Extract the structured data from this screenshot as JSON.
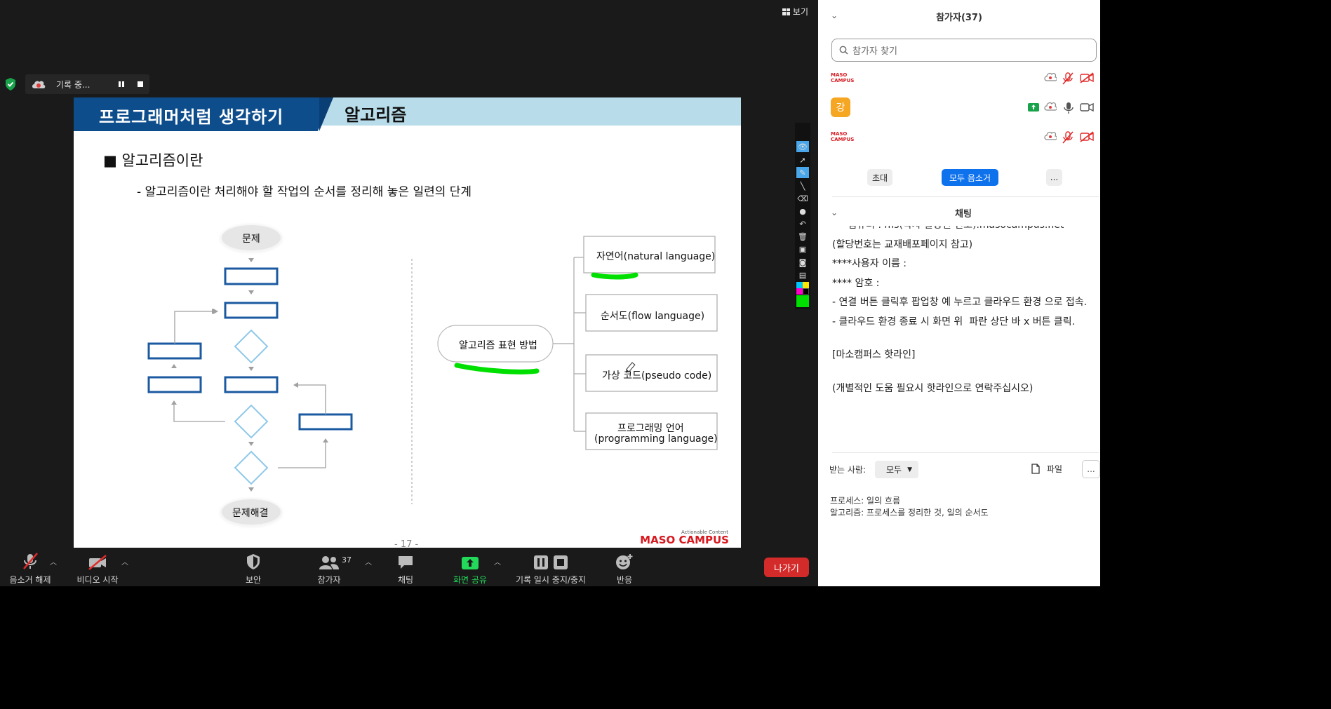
{
  "meeting": {
    "view_label": "보기",
    "recording_label": "기록 중...",
    "leave_label": "나가기"
  },
  "toolbar": {
    "mute": "음소거 해제",
    "video": "비디오 시작",
    "security": "보안",
    "participants": "참가자",
    "participants_count": "37",
    "chat": "채팅",
    "share": "화면 공유",
    "record": "기록 일시 중지/중지",
    "reactions": "반응"
  },
  "slide": {
    "title": "프로그래머처럼 생각하기",
    "subject": "알고리즘",
    "bullet_head": "■ 알고리즘이란",
    "bullet_sub": "- 알고리즘이란 처리해야 할 작업의 순서를 정리해 놓은 일련의 단계",
    "flow_start": "문제",
    "flow_end": "문제해결",
    "center_node": "알고리즘 표현 방법",
    "branches": [
      "자연어(natural language)",
      "순서도(flow language)",
      "가상 코드(pseudo code)",
      "프로그래밍 언어",
      "(programming language)"
    ],
    "page_number": "- 17 -",
    "brand_tagline": "Actionable Content",
    "brand_name": "MASO CAMPUS"
  },
  "panel": {
    "participants_title": "참가자(37)",
    "search_placeholder": "참가자 찾기",
    "logo_text": "MASO CAMPUS",
    "avatar_letter": "강",
    "invite": "초대",
    "mute_all": "모두 음소거",
    "more": "...",
    "chat_title": "채팅",
    "chat_lines": [
      "     컴퓨터 : ms(각자 할당된 번호).masocampus.net",
      "(할당번호는 교재배포페이지 참고)",
      "****사용자 이름 :",
      "**** 암호 : ",
      "- 연결 버튼 클릭후 팝업창 예 누르고 클라우드 환경 으로 접속.",
      "- 클라우드 환경 종료 시 화면 위  파란 상단 바 x 버튼 클릭.",
      "",
      "[마소캠퍼스 핫라인]",
      "",
      "(개별적인 도움 필요시 핫라인으로 연락주십시오)"
    ],
    "to_label": "받는 사람:",
    "to_value": "모두",
    "file_label": "파일",
    "compose_lines": [
      "프로세스: 일의 흐름",
      "알고리즘: 프로세스를 정리한 것, 일의 순서도"
    ]
  },
  "colors": {
    "slide_blue": "#0e4d8c",
    "slide_header_light": "#b9dcea",
    "highlight_green": "#00e000",
    "brand_red": "#d71920",
    "mute_all_blue": "#0e72ed",
    "leave_red": "#d32a2a",
    "share_green": "#23d959"
  }
}
